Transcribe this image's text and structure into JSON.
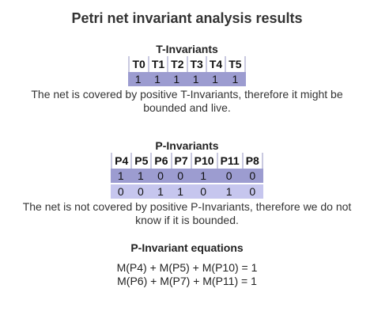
{
  "title": "Petri net invariant analysis results",
  "t_invariants": {
    "heading": "T-Invariants",
    "columns": [
      "T0",
      "T1",
      "T2",
      "T3",
      "T4",
      "T5"
    ],
    "rows": [
      [
        "1",
        "1",
        "1",
        "1",
        "1",
        "1"
      ]
    ],
    "note": "The net is covered by positive T-Invariants, therefore it might be bounded and live."
  },
  "p_invariants": {
    "heading": "P-Invariants",
    "columns": [
      "P4",
      "P5",
      "P6",
      "P7",
      "P10",
      "P11",
      "P8"
    ],
    "rows": [
      [
        "1",
        "1",
        "0",
        "0",
        "1",
        "0",
        "0"
      ],
      [
        "0",
        "0",
        "1",
        "1",
        "0",
        "1",
        "0"
      ]
    ],
    "note": "The net is not covered by positive P-Invariants, therefore we do not know if it is bounded."
  },
  "equations": {
    "heading": "P-Invariant equations",
    "lines": [
      "M(P4) + M(P5) + M(P10) = 1",
      "M(P6) + M(P7) + M(P11) = 1"
    ]
  },
  "colors": {
    "row_dark": "#9c9cd0",
    "row_light": "#c6c6ee",
    "header_divider": "#c9c9e0"
  }
}
